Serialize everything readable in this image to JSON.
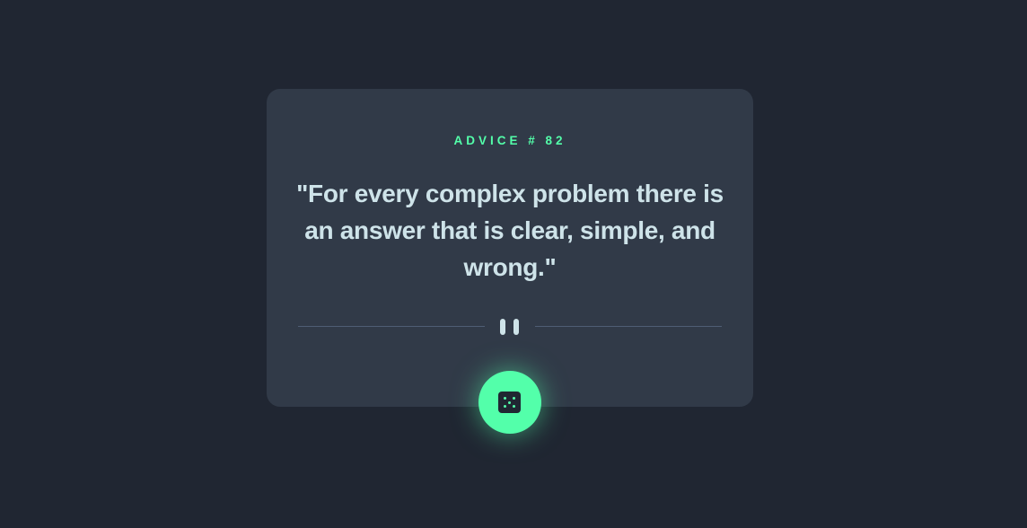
{
  "advice": {
    "label": "ADVICE # 82",
    "quote": "\"For every complex problem there is an answer that is clear, simple, and wrong.\""
  },
  "divider": {
    "icon": "pause-icon"
  },
  "button": {
    "icon": "dice-icon",
    "action": "generate-new-advice"
  },
  "colors": {
    "background": "#202632",
    "card": "#313a48",
    "accent": "#53ffaa",
    "text": "#cee3e9",
    "divider": "#4f5d74"
  }
}
